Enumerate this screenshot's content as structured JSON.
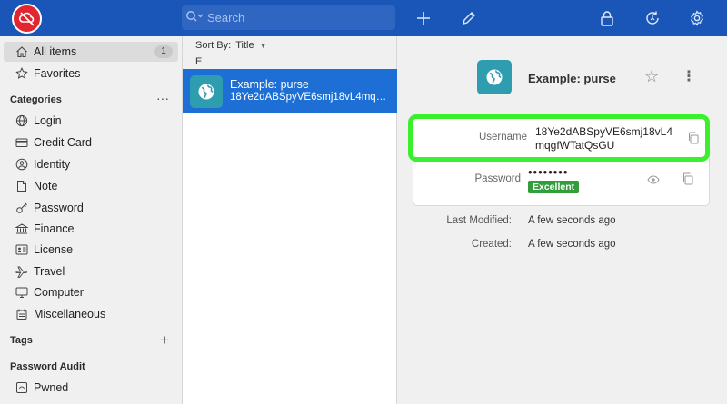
{
  "colors": {
    "topbar": "#1a56b8",
    "accent": "#1d6fd6",
    "logo": "#e0262f",
    "highlight": "#39f02a",
    "strength": "#2f9e3b",
    "item_icon_bg": "#2e9db0"
  },
  "toolbar": {
    "search_placeholder": "Search",
    "icons": [
      "logo-icon",
      "search-icon",
      "add-icon",
      "edit-icon",
      "lock-icon",
      "sync-icon",
      "settings-icon"
    ]
  },
  "sidebar": {
    "all_items": {
      "label": "All items",
      "count": "1"
    },
    "favorites": {
      "label": "Favorites"
    },
    "categories_heading": "Categories",
    "categories_more": "···",
    "categories": [
      {
        "label": "Login",
        "icon": "globe-icon"
      },
      {
        "label": "Credit Card",
        "icon": "credit-card-icon"
      },
      {
        "label": "Identity",
        "icon": "identity-icon"
      },
      {
        "label": "Note",
        "icon": "note-icon"
      },
      {
        "label": "Password",
        "icon": "key-icon"
      },
      {
        "label": "Finance",
        "icon": "finance-icon"
      },
      {
        "label": "License",
        "icon": "license-icon"
      },
      {
        "label": "Travel",
        "icon": "plane-icon"
      },
      {
        "label": "Computer",
        "icon": "computer-icon"
      },
      {
        "label": "Miscellaneous",
        "icon": "misc-icon"
      }
    ],
    "tags_heading": "Tags",
    "tags_add": "+",
    "audit_heading": "Password Audit",
    "audit_items": [
      {
        "label": "Pwned",
        "icon": "pwned-icon"
      }
    ]
  },
  "list": {
    "sort_label": "Sort By:",
    "sort_value": "Title",
    "group_letter": "E",
    "items": [
      {
        "title": "Example: purse",
        "subtitle": "18Ye2dABSpyVE6smj18vL4mqgfWTatQsGU",
        "icon": "globe-icon"
      }
    ]
  },
  "detail": {
    "title": "Example: purse",
    "username_label": "Username",
    "username_value": "18Ye2dABSpyVE6smj18vL4mqgfWTatQsGU",
    "password_label": "Password",
    "password_dots": "••••••••",
    "password_strength": "Excellent",
    "last_modified_label": "Last Modified:",
    "last_modified_value": "A few seconds ago",
    "created_label": "Created:",
    "created_value": "A few seconds ago"
  }
}
